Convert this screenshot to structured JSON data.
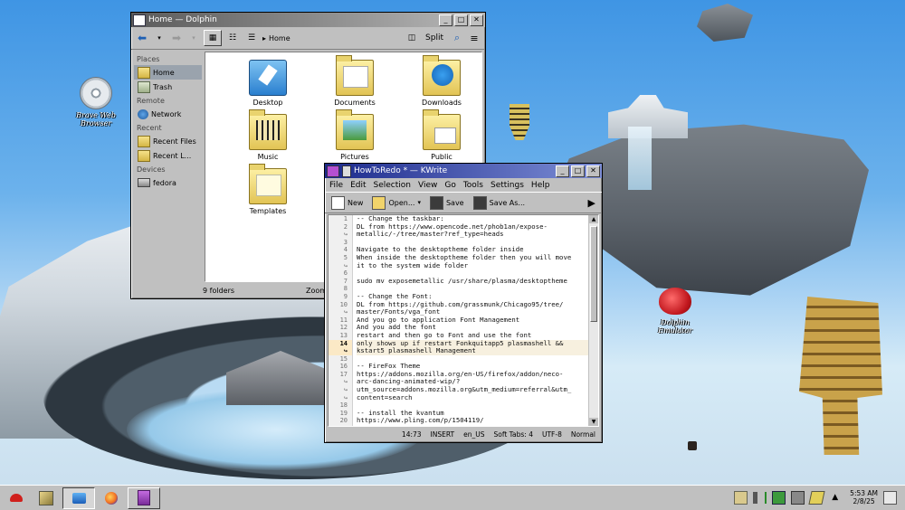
{
  "desktop": {
    "icons": [
      {
        "label": "Brave Web Browser",
        "icon": "cd-icon"
      },
      {
        "label": "Dolphin Emulator",
        "icon": "strawberry-icon"
      }
    ]
  },
  "dolphin": {
    "title": "Home — Dolphin",
    "breadcrumb": "Home",
    "split_label": "Split",
    "places": {
      "sections": [
        {
          "title": "Places",
          "items": [
            {
              "label": "Home",
              "selected": true
            },
            {
              "label": "Trash"
            }
          ]
        },
        {
          "title": "Remote",
          "items": [
            {
              "label": "Network"
            }
          ]
        },
        {
          "title": "Recent",
          "items": [
            {
              "label": "Recent Files"
            },
            {
              "label": "Recent L..."
            }
          ]
        },
        {
          "title": "Devices",
          "items": [
            {
              "label": "fedora"
            }
          ]
        }
      ]
    },
    "files": [
      {
        "label": "Desktop"
      },
      {
        "label": "Documents"
      },
      {
        "label": "Downloads"
      },
      {
        "label": "Music"
      },
      {
        "label": "Pictures"
      },
      {
        "label": "Public"
      },
      {
        "label": "Templates"
      }
    ],
    "status": "9 folders",
    "zoom_label": "Zoom:"
  },
  "kwrite": {
    "title": "HowToRedo * — KWrite",
    "menu": [
      "File",
      "Edit",
      "Selection",
      "View",
      "Go",
      "Tools",
      "Settings",
      "Help"
    ],
    "toolbar": {
      "new": "New",
      "open": "Open...",
      "save": "Save",
      "save_as": "Save As..."
    },
    "lines": [
      {
        "num": "1",
        "text": "-- Change the taskbar:"
      },
      {
        "num": "2",
        "text": "DL from https://www.opencode.net/phob1an/expose-"
      },
      {
        "num": "↪",
        "text": "metallic/-/tree/master?ref_type=heads"
      },
      {
        "num": "3",
        "text": ""
      },
      {
        "num": "4",
        "text": "Navigate to the desktoptheme folder inside"
      },
      {
        "num": "5",
        "text": "When inside the desktoptheme folder then you will move"
      },
      {
        "num": "↪",
        "text": "it to the system wide folder"
      },
      {
        "num": "6",
        "text": ""
      },
      {
        "num": "7",
        "text": "sudo mv exposemetallic /usr/share/plasma/desktoptheme"
      },
      {
        "num": "8",
        "text": ""
      },
      {
        "num": "9",
        "text": "-- Change the Font:"
      },
      {
        "num": "10",
        "text": "DL from https://github.com/grassmunk/Chicago95/tree/"
      },
      {
        "num": "↪",
        "text": "master/Fonts/vga_font"
      },
      {
        "num": "11",
        "text": "And you go to application Font Management"
      },
      {
        "num": "12",
        "text": "And you add the font"
      },
      {
        "num": "13",
        "text": "restart and then go to Font and use the font"
      },
      {
        "num": "14",
        "text": "only shows up if restart Fonkquitapp5 plasmashell &&",
        "current": true
      },
      {
        "num": "↪",
        "text": "kstart5 plasmashell Management",
        "current": true
      },
      {
        "num": "15",
        "text": ""
      },
      {
        "num": "16",
        "text": "-- FireFox Theme"
      },
      {
        "num": "17",
        "text": "https://addons.mozilla.org/en-US/firefox/addon/neco-"
      },
      {
        "num": "↪",
        "text": "arc-dancing-animated-wip/?"
      },
      {
        "num": "↪",
        "text": "utm_source=addons.mozilla.org&utm_medium=referral&utm_"
      },
      {
        "num": "↪",
        "text": "content=search"
      },
      {
        "num": "18",
        "text": ""
      },
      {
        "num": "19",
        "text": "-- install the kvantum"
      },
      {
        "num": "20",
        "text": "https://www.pling.com/p/1504119/"
      },
      {
        "num": "21",
        "text": ""
      }
    ],
    "status": {
      "position": "14:73",
      "mode": "INSERT",
      "lang": "en_US",
      "tabs": "Soft Tabs: 4",
      "encoding": "UTF-8",
      "eol": "Normal"
    }
  },
  "taskbar": {
    "clock_time": "5:53 AM",
    "clock_date": "2/8/25"
  }
}
